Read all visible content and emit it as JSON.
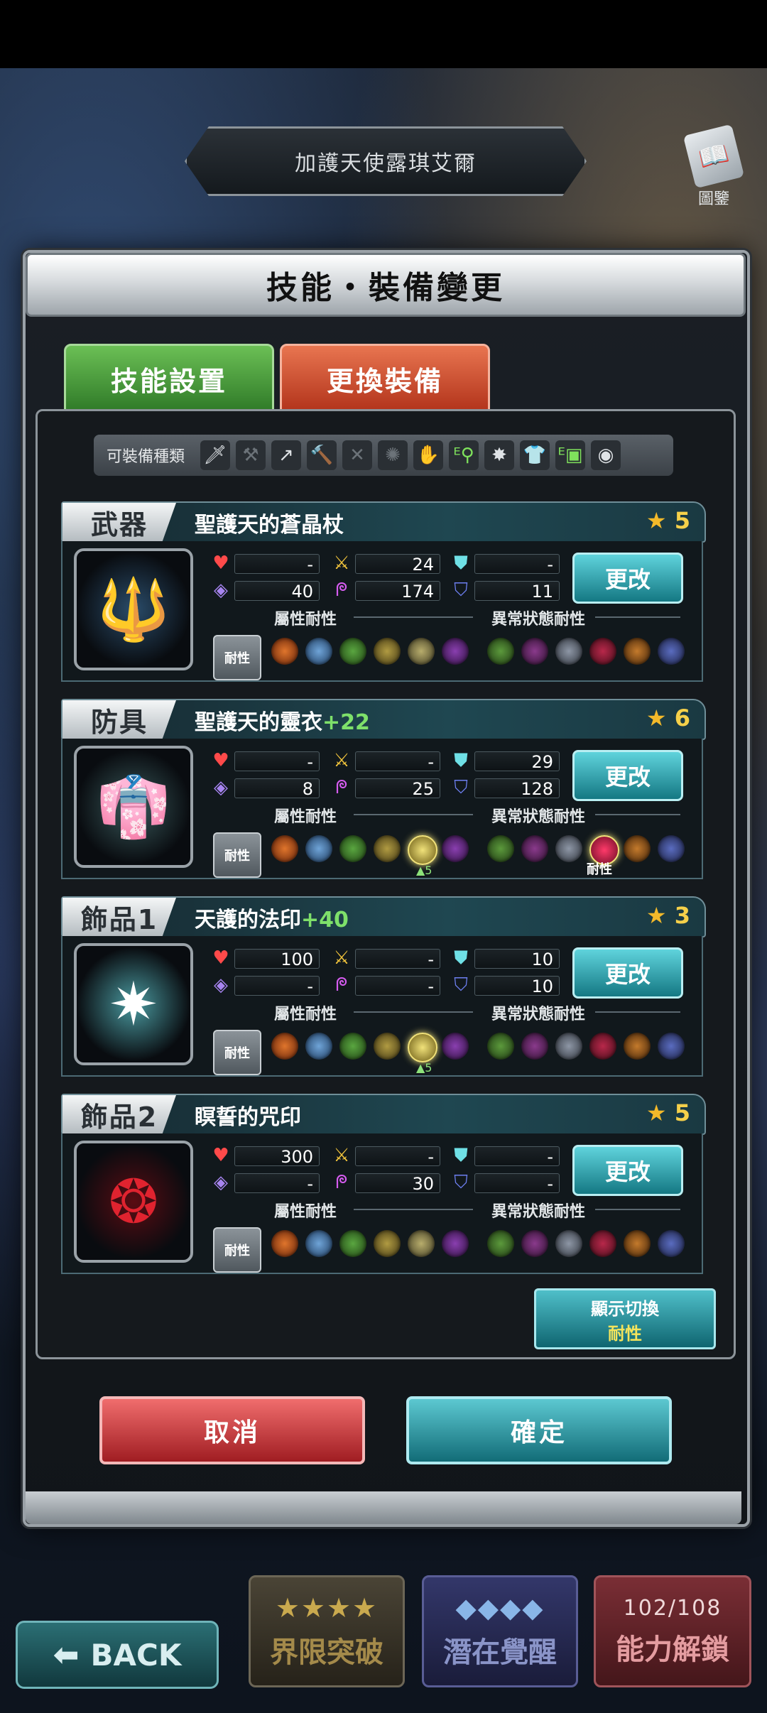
{
  "character_name": "加護天使露琪艾爾",
  "book": {
    "label": "圖鑒",
    "icon": "book-icon"
  },
  "modal": {
    "title": "技能・裝備變更",
    "tabs": {
      "skill": "技能設置",
      "equip": "更換裝備"
    },
    "equip_types": {
      "label": "可裝備種類",
      "icons": [
        "sword",
        "axe",
        "spear",
        "hammer",
        "dual-blade",
        "mace",
        "claw",
        "e-staff",
        "heavy-armor",
        "light-armor",
        "e-robe",
        "accessory"
      ]
    },
    "attr_label": "屬性耐性",
    "status_label": "異常狀態耐性",
    "res_button": "耐性",
    "change_label": "更改",
    "toggle": {
      "line1": "顯示切換",
      "line2": "耐性"
    },
    "cancel": "取消",
    "confirm": "確定"
  },
  "items": [
    {
      "slot": "武器",
      "name": "聖護天的蒼晶杖",
      "plus": "",
      "rarity": "5",
      "stats": {
        "hp": "-",
        "atk": "24",
        "def": "-",
        "mp": "40",
        "matk": "174",
        "mdef": "11"
      }
    },
    {
      "slot": "防具",
      "name": "聖護天的靈衣",
      "plus": "+22",
      "rarity": "6",
      "stats": {
        "hp": "-",
        "atk": "-",
        "def": "29",
        "mp": "8",
        "matk": "25",
        "mdef": "128"
      },
      "notes": {
        "light_up": "▲5",
        "status_tag": "耐性"
      }
    },
    {
      "slot": "飾品1",
      "name": "天護的法印",
      "plus": "+40",
      "rarity": "3",
      "stats": {
        "hp": "100",
        "atk": "-",
        "def": "10",
        "mp": "-",
        "matk": "-",
        "mdef": "10"
      },
      "notes": {
        "light_up": "▲5"
      }
    },
    {
      "slot": "飾品2",
      "name": "瞑誓的咒印",
      "plus": "",
      "rarity": "5",
      "stats": {
        "hp": "300",
        "atk": "-",
        "def": "-",
        "mp": "-",
        "matk": "30",
        "mdef": "-"
      }
    }
  ],
  "bottom": {
    "back": "BACK",
    "limit_break": "界限突破",
    "awakening": "潛在覺醒",
    "ability_unlock": "能力解鎖",
    "ability_count": "102/108"
  },
  "colors": {
    "accent_teal": "#147883",
    "cancel_red": "#a01d22",
    "equip_tab": "#b2331b",
    "skill_tab": "#2f7a28",
    "star": "#f3b92a",
    "plus_green": "#7ee06a"
  }
}
